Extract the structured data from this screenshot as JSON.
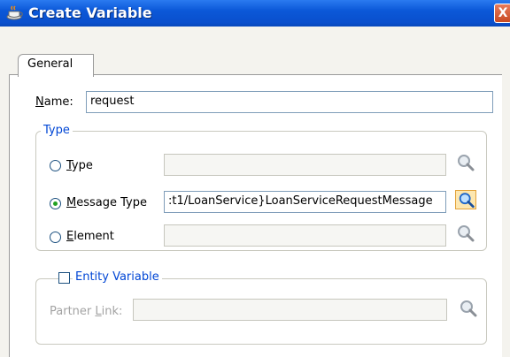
{
  "window": {
    "title": "Create Variable",
    "close_label": "X"
  },
  "tabs": [
    {
      "label": "General"
    }
  ],
  "name_field": {
    "label_underlined": "N",
    "label_rest": "ame:",
    "value": "request"
  },
  "type_group": {
    "legend": "Type",
    "options": [
      {
        "label_underlined": "T",
        "label_rest": "ype",
        "selected": false,
        "value": ""
      },
      {
        "label_underlined": "M",
        "label_rest": "essage Type",
        "selected": true,
        "value": ":t1/LoanService}LoanServiceRequestMessage"
      },
      {
        "label_underlined": "E",
        "label_rest": "lement",
        "selected": false,
        "value": ""
      }
    ]
  },
  "entity_group": {
    "legend": "Entity Variable",
    "checked": false,
    "partner_link": {
      "label_prefix": "Partner ",
      "label_underlined": "L",
      "label_rest": "ink:",
      "value": ""
    }
  },
  "icons": {
    "app": "coffee-cup-icon",
    "browse": "magnifier-icon"
  },
  "colors": {
    "titlebar": "#0b58d8",
    "legend": "#0046d5",
    "radio_selected": "#21a121",
    "active_browse": "#fde7b0"
  }
}
